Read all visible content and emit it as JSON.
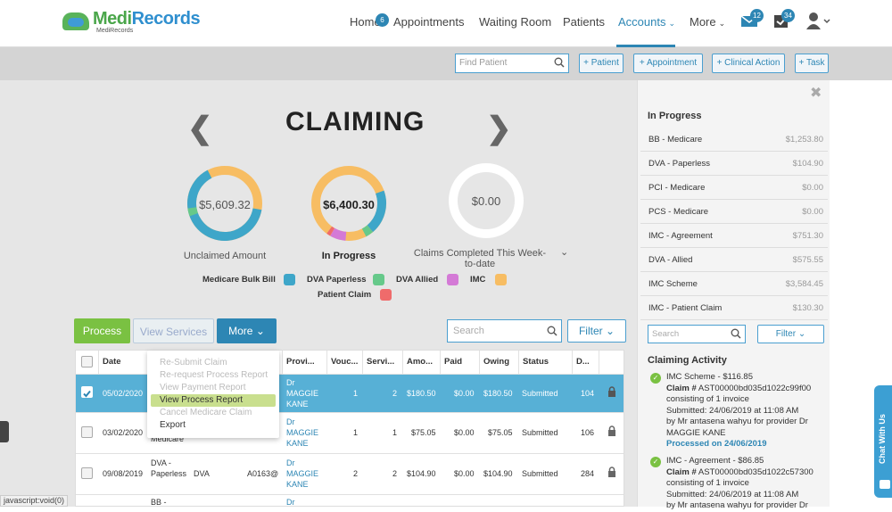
{
  "brand": {
    "name_part1": "Medi",
    "name_part2": "Records",
    "sub": "MediRecords"
  },
  "nav": {
    "home": "Home",
    "home_badge": "6",
    "appointments": "Appointments",
    "waiting_room": "Waiting Room",
    "patients": "Patients",
    "accounts": "Accounts",
    "more": "More",
    "mail_badge": "12",
    "tasks_badge": "34"
  },
  "toolbar": {
    "find_patient_placeholder": "Find Patient",
    "add_patient": "+ Patient",
    "add_appointment": "+ Appointment",
    "add_clinical_action": "+ Clinical Action",
    "add_task": "+ Task"
  },
  "claiming": {
    "title": "CLAIMING",
    "unclaimed_value": "$5,609.32",
    "unclaimed_label": "Unclaimed Amount",
    "in_progress_value": "$6,400.30",
    "in_progress_label": "In Progress",
    "completed_value": "$0.00",
    "completed_label": "Claims Completed This Week-to-date"
  },
  "legend": [
    {
      "label": "Medicare Bulk Bill",
      "color": "#3ea6c9"
    },
    {
      "label": "DVA Paperless",
      "color": "#66c98a"
    },
    {
      "label": "DVA Allied",
      "color": "#d47ad6"
    },
    {
      "label": "IMC",
      "color": "#f7bd63"
    },
    {
      "label": "Patient Claim",
      "color": "#ef6b6b"
    }
  ],
  "actions": {
    "process": "Process",
    "view_services": "View Services",
    "more": "More",
    "search_placeholder": "Search",
    "filter": "Filter"
  },
  "dropdown": {
    "items": [
      "Re-Submit Claim",
      "Re-request Process Report",
      "View Payment Report",
      "View Process Report",
      "Cancel Medicare Claim",
      "Export"
    ]
  },
  "table": {
    "headers": [
      "Date",
      "",
      "",
      "Provi...",
      "Vouc...",
      "Servi...",
      "Amo...",
      "Paid",
      "Owing",
      "Status",
      "D..."
    ],
    "rows": [
      {
        "date": "05/02/2020",
        "col2": "",
        "col3": "",
        "provider": "Dr MAGGIE KANE",
        "vouchers": "1",
        "services": "2",
        "amount": "$180.50",
        "paid": "$0.00",
        "owing": "$180.50",
        "status": "Submitted",
        "d": "104"
      },
      {
        "date": "03/02/2020",
        "col2": "Medicare",
        "col3": "",
        "provider": "Dr MAGGIE KANE",
        "vouchers": "1",
        "services": "1",
        "amount": "$75.05",
        "paid": "$0.00",
        "owing": "$75.05",
        "status": "Submitted",
        "d": "106"
      },
      {
        "date": "09/08/2019",
        "col2": "DVA - Paperless",
        "col3": "DVA",
        "col4": "A0163@",
        "provider": "Dr MAGGIE KANE",
        "vouchers": "2",
        "services": "2",
        "amount": "$104.90",
        "paid": "$0.00",
        "owing": "$104.90",
        "status": "Submitted",
        "d": "284"
      },
      {
        "date": "",
        "col2": "BB -",
        "col3": "",
        "provider": "Dr",
        "vouchers": "",
        "services": "",
        "amount": "",
        "paid": "",
        "owing": "",
        "status": "",
        "d": ""
      }
    ]
  },
  "right_panel": {
    "in_progress_title": "In Progress",
    "items": [
      {
        "name": "BB - Medicare",
        "value": "$1,253.80"
      },
      {
        "name": "DVA - Paperless",
        "value": "$104.90"
      },
      {
        "name": "PCI - Medicare",
        "value": "$0.00"
      },
      {
        "name": "PCS - Medicare",
        "value": "$0.00"
      },
      {
        "name": "IMC - Agreement",
        "value": "$751.30"
      },
      {
        "name": "DVA - Allied",
        "value": "$575.55"
      },
      {
        "name": "IMC Scheme",
        "value": "$3,584.45"
      },
      {
        "name": "IMC - Patient Claim",
        "value": "$130.30"
      }
    ],
    "search_placeholder": "Search",
    "filter": "Filter",
    "activity_title": "Claiming Activity",
    "activity": [
      {
        "heading": "IMC Scheme - $116.85",
        "claim_label": "Claim #",
        "claim_no": "AST00000bd035d1022c99f00",
        "line1": "consisting of 1 invoice",
        "line2": "Submitted: 24/06/2019 at 11:08 AM",
        "line3": "by Mr antasena wahyu for provider Dr MAGGIE KANE",
        "status": "Processed on 24/06/2019"
      },
      {
        "heading": "IMC - Agreement - $86.85",
        "claim_label": "Claim #",
        "claim_no": "AST00000bd035d1022c57300",
        "line1": "consisting of 1 invoice",
        "line2": "Submitted: 24/06/2019 at 11:08 AM",
        "line3": "by Mr antasena wahyu for provider Dr"
      }
    ]
  },
  "chat": {
    "label": "Chat With Us"
  },
  "status_bar": {
    "text": "javascript:void(0)"
  }
}
